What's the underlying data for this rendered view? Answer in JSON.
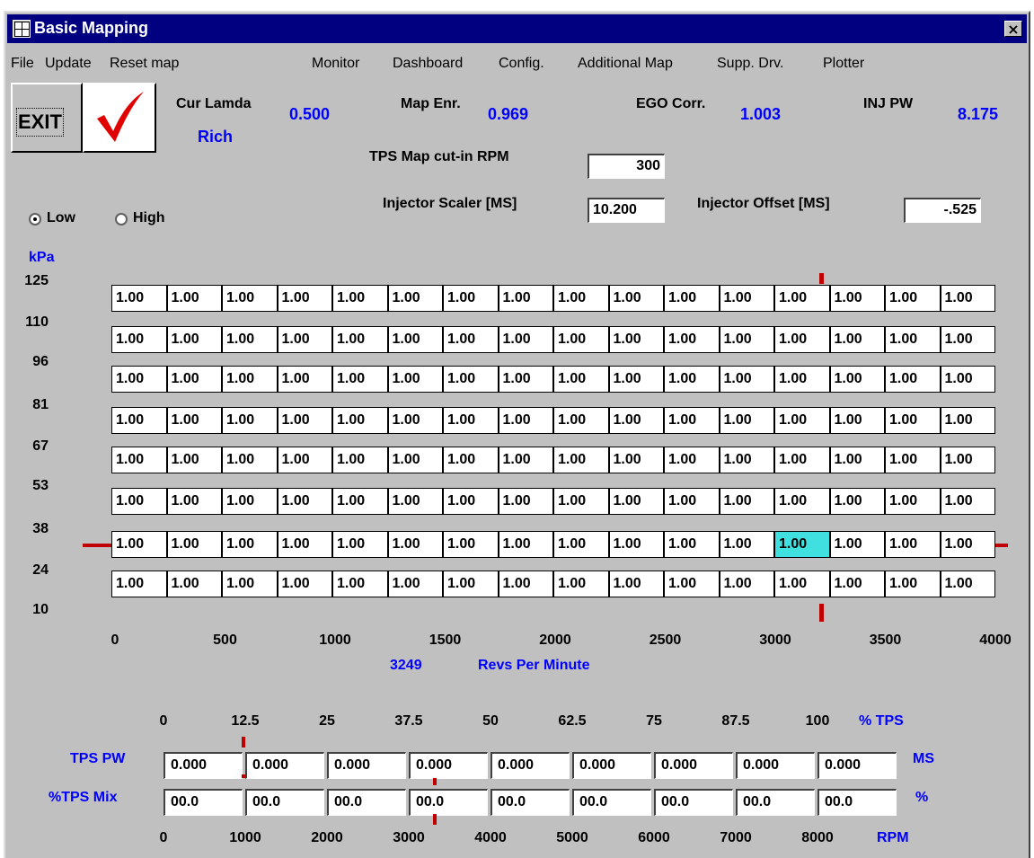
{
  "window": {
    "title": "Basic Mapping",
    "close_label": "×"
  },
  "menu": [
    "File",
    "Update",
    "Reset map",
    "Monitor",
    "Dashboard",
    "Config.",
    "Additional Map",
    "Supp. Drv.",
    "Plotter"
  ],
  "toolbar": {
    "exit_label": "EXIT"
  },
  "readouts": {
    "cur_lamda_label": "Cur Lamda",
    "cur_lamda_value": "0.500",
    "mixture_status": "Rich",
    "map_enr_label": "Map Enr.",
    "map_enr_value": "0.969",
    "ego_corr_label": "EGO Corr.",
    "ego_corr_value": "1.003",
    "inj_pw_label": "INJ PW",
    "inj_pw_value": "8.175"
  },
  "settings": {
    "tps_cutin_label": "TPS Map cut-in RPM",
    "tps_cutin_value": "300",
    "inj_scaler_label": "Injector Scaler [MS]",
    "inj_scaler_value": "10.200",
    "inj_offset_label": "Injector Offset [MS]",
    "inj_offset_value": "-.525"
  },
  "range": {
    "low_label": "Low",
    "high_label": "High",
    "selected": "Low"
  },
  "map": {
    "y_unit": "kPa",
    "y_labels": [
      "125",
      "110",
      "96",
      "81",
      "67",
      "53",
      "38",
      "24",
      "10"
    ],
    "x_labels": [
      "0",
      "500",
      "1000",
      "1500",
      "2000",
      "2500",
      "3000",
      "3500",
      "4000"
    ],
    "rows": 8,
    "cols": 16,
    "cell_value": "1.00",
    "selected_row": 6,
    "selected_col": 12,
    "rpm_value": "3249",
    "rpm_label": "Revs Per Minute"
  },
  "tps": {
    "pct_labels": [
      "0",
      "12.5",
      "25",
      "37.5",
      "50",
      "62.5",
      "75",
      "87.5",
      "100"
    ],
    "pct_unit": "% TPS",
    "pw_label": "TPS PW",
    "pw_values": [
      "0.000",
      "0.000",
      "0.000",
      "0.000",
      "0.000",
      "0.000",
      "0.000",
      "0.000",
      "0.000"
    ],
    "pw_unit": "MS",
    "mix_label": "%TPS Mix",
    "mix_values": [
      "00.0",
      "00.0",
      "00.0",
      "00.0",
      "00.0",
      "00.0",
      "00.0",
      "00.0",
      "00.0"
    ],
    "mix_unit": "%",
    "rpm_labels": [
      "0",
      "1000",
      "2000",
      "3000",
      "4000",
      "5000",
      "6000",
      "7000",
      "8000"
    ],
    "rpm_unit": "RPM"
  },
  "colors": {
    "title_bar": "#000080",
    "value_text": "#0000ff",
    "selected_cell": "#40e0e0",
    "marker": "#c00000"
  }
}
